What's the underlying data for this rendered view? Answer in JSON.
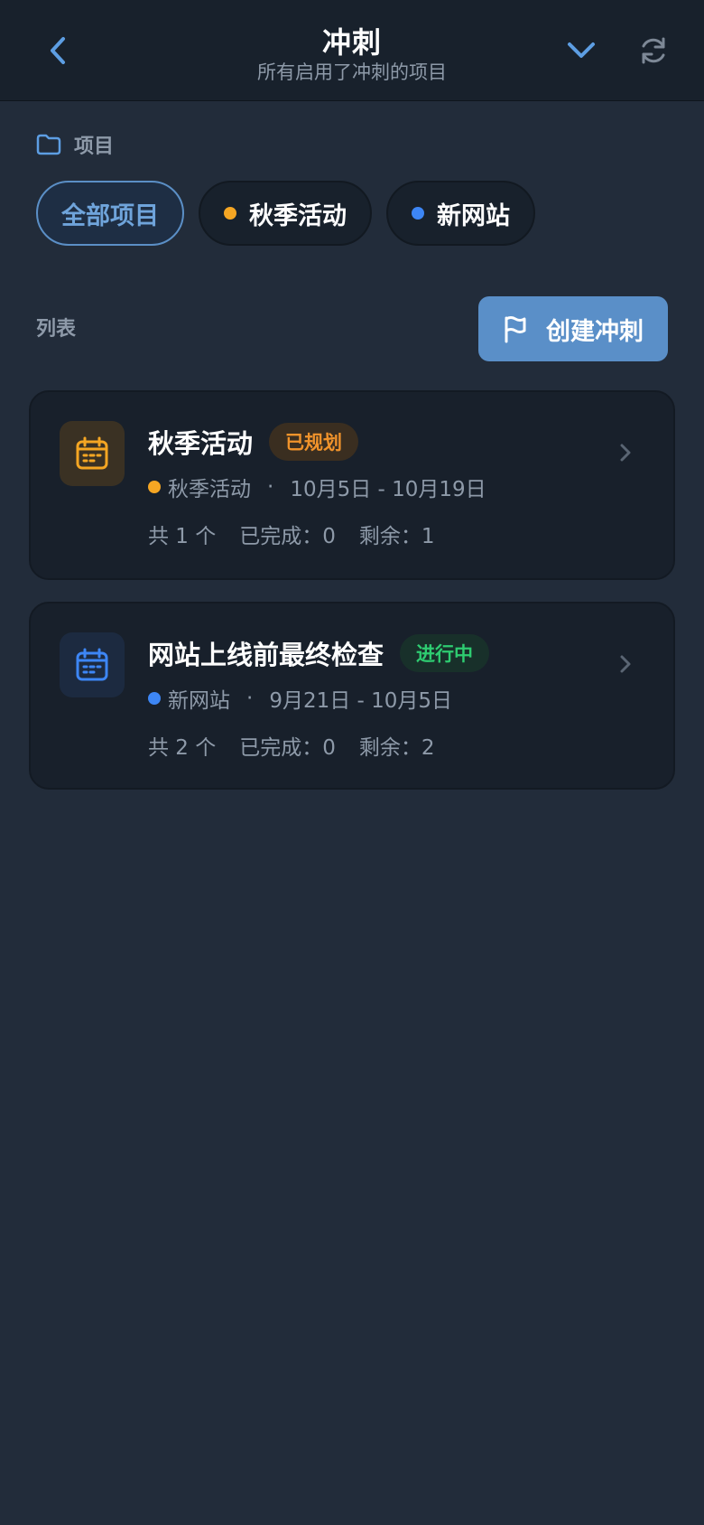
{
  "header": {
    "title": "冲刺",
    "subtitle": "所有启用了冲刺的项目",
    "icons": [
      "back-arrow-icon",
      "chevron-down-icon",
      "refresh-icon"
    ]
  },
  "projects_section": {
    "label": "项目",
    "icon": "folder-icon",
    "filters": [
      {
        "label": "全部项目",
        "active": true
      },
      {
        "label": "秋季活动",
        "dot_color": "#f5a623",
        "active": false
      },
      {
        "label": "新网站",
        "dot_color": "#3d86f5",
        "active": false
      }
    ]
  },
  "list": {
    "label": "列表",
    "create_button": {
      "label": "创建冲刺",
      "icon": "flag-icon"
    }
  },
  "colors": {
    "accent": "#5a8fc8",
    "planned": "#f0932b",
    "in_progress": "#2ecc71"
  },
  "sprints": [
    {
      "title": "秋季活动",
      "status": "已规划",
      "project": "秋季活动",
      "project_dot": "#f5a623",
      "separator": "·",
      "dates": "10月5日 - 10月19日",
      "total": "共 1 个",
      "completed": "已完成：0",
      "remaining": "剩余：1",
      "icon": "calendar-icon"
    },
    {
      "title": "网站上线前最终检查",
      "status": "进行中",
      "project": "新网站",
      "project_dot": "#3d86f5",
      "separator": "·",
      "dates": "9月21日 - 10月5日",
      "total": "共 2 个",
      "completed": "已完成：0",
      "remaining": "剩余：2",
      "icon": "calendar-icon"
    }
  ]
}
